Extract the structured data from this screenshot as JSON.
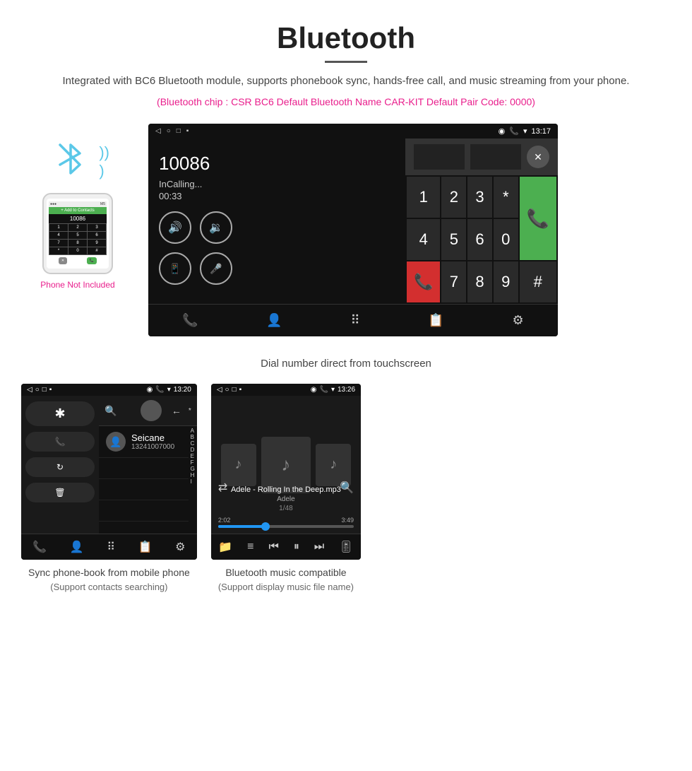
{
  "header": {
    "title": "Bluetooth",
    "description": "Integrated with BC6 Bluetooth module, supports phonebook sync, hands-free call, and music streaming from your phone.",
    "specs": "(Bluetooth chip : CSR BC6    Default Bluetooth Name CAR-KIT    Default Pair Code: 0000)"
  },
  "phone_illustration": {
    "not_included": "Phone Not Included"
  },
  "dial_screen": {
    "status_time": "13:17",
    "number": "10086",
    "call_status": "InCalling...",
    "timer": "00:33",
    "keys": [
      "1",
      "2",
      "3",
      "*",
      "4",
      "5",
      "6",
      "0",
      "7",
      "8",
      "9",
      "#"
    ]
  },
  "caption_main": "Dial number direct from touchscreen",
  "phonebook_screen": {
    "status_time": "13:20",
    "contact_name": "Seicane",
    "contact_phone": "13241007000",
    "alphabet": [
      "A",
      "B",
      "C",
      "D",
      "E",
      "F",
      "G",
      "H",
      "I"
    ]
  },
  "caption_phonebook": "Sync phone-book from mobile phone\n(Support contacts searching)",
  "music_screen": {
    "status_time": "13:26",
    "track_name": "Adele - Rolling In the Deep.mp3",
    "artist": "Adele",
    "track_index": "1/48",
    "time_current": "2:02",
    "time_total": "3:49"
  },
  "caption_music": "Bluetooth music compatible\n(Support display music file name)"
}
